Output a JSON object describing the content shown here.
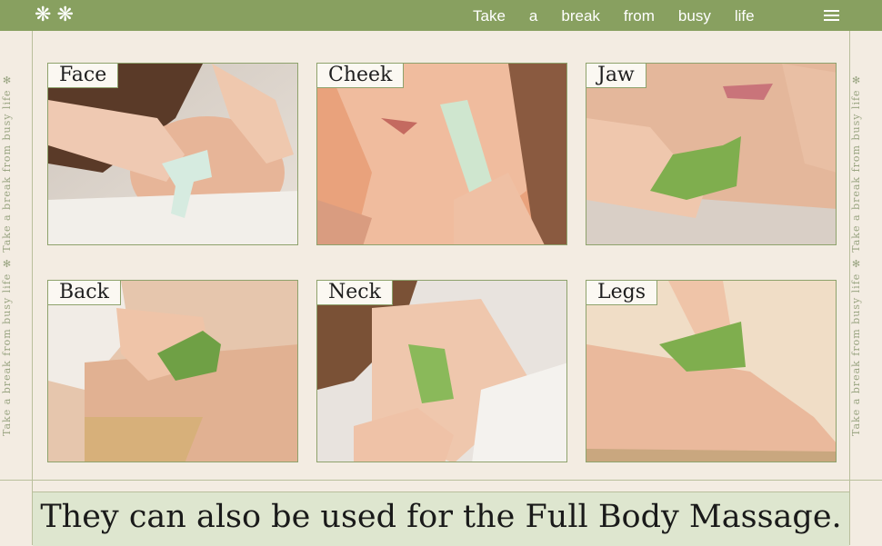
{
  "header": {
    "tagline": [
      "Take",
      "a",
      "break",
      "from",
      "busy",
      "life"
    ]
  },
  "side_text": "Take   a   break   from   busy   life   ✻   Take   a   break   from   busy   life   ✻",
  "cards": [
    {
      "label": "Face"
    },
    {
      "label": "Cheek"
    },
    {
      "label": "Jaw"
    },
    {
      "label": "Back"
    },
    {
      "label": "Neck"
    },
    {
      "label": "Legs"
    }
  ],
  "caption": "They can also be used for the Full Body Massage.",
  "colors": {
    "bar_green": "#88a060",
    "background": "#f3ece2",
    "jade": "#a9d08c",
    "caption_band": "#dee6cf"
  }
}
